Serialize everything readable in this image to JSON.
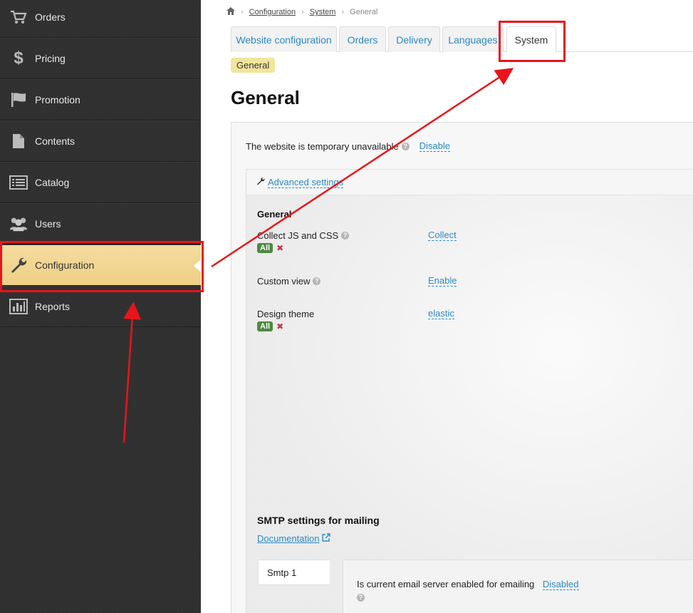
{
  "sidebar": {
    "items": [
      {
        "label": "Orders",
        "icon": "cart-icon"
      },
      {
        "label": "Pricing",
        "icon": "dollar-icon"
      },
      {
        "label": "Promotion",
        "icon": "flag-icon"
      },
      {
        "label": "Contents",
        "icon": "document-icon"
      },
      {
        "label": "Catalog",
        "icon": "list-icon"
      },
      {
        "label": "Users",
        "icon": "users-icon"
      },
      {
        "label": "Configuration",
        "icon": "wrench-icon",
        "active": true
      },
      {
        "label": "Reports",
        "icon": "bar-chart-icon"
      }
    ]
  },
  "breadcrumb": {
    "home_icon": "home-icon",
    "items": [
      "Configuration",
      "System",
      "General"
    ]
  },
  "tabs": [
    "Website configuration",
    "Orders",
    "Delivery",
    "Languages",
    "System"
  ],
  "active_tab": "System",
  "badge": "General",
  "page_title": "General",
  "temporary": {
    "label": "The website is temporary unavailable",
    "action": "Disable"
  },
  "advanced": {
    "link": "Advanced settings",
    "section_title": "General",
    "options": [
      {
        "label": "Collect JS and CSS",
        "value": "Collect",
        "scope": "All"
      },
      {
        "label": "Custom view",
        "value": "Enable"
      },
      {
        "label": "Design theme",
        "value": "elastic",
        "scope": "All"
      }
    ]
  },
  "smtp": {
    "title": "SMTP settings for mailing",
    "doc_link": "Documentation",
    "tab": "Smtp 1",
    "enabled_label": "Is current email server enabled for emailing",
    "enabled_value": "Disabled"
  },
  "colors": {
    "sidebar_bg": "#2f2f2f",
    "active_item": "#f0d48f",
    "link": "#2a8ac6",
    "annotation": "#e8151b"
  }
}
